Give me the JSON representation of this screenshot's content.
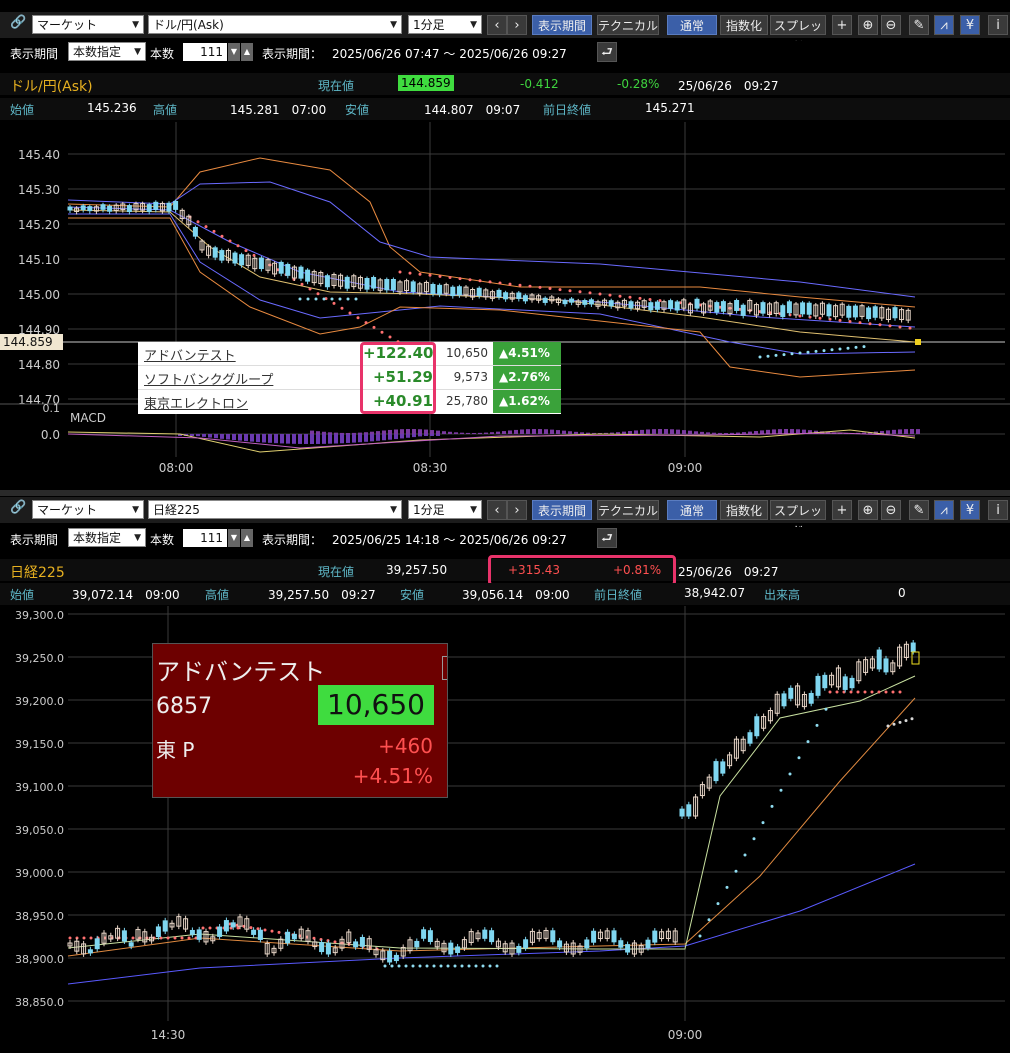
{
  "top": {
    "toolbar": {
      "market": "マーケット",
      "symbol": "ドル/円(Ask)",
      "interval": "1分足",
      "prev": "‹",
      "next": "›",
      "display_period": "表示期間",
      "technical": "テクニカル",
      "normal": "通常",
      "index": "指数化",
      "spread": "スプレッド"
    },
    "period_row": {
      "label": "表示期間",
      "mode": "本数指定",
      "count_label": "本数",
      "count": "111",
      "range_label": "表示期間：",
      "range": "2025/06/26 07:47 ～ 2025/06/26 09:27"
    },
    "quote": {
      "name": "ドル/円(Ask)",
      "current_label": "現在値",
      "current": "144.859",
      "change": "-0.412",
      "change_pct": "-0.28%",
      "datetime": "25/06/26　09:27"
    },
    "ohlc": {
      "open_label": "始値",
      "open": "145.236",
      "high_label": "高値",
      "high": "145.281　07:00",
      "low_label": "安値",
      "low": "144.807　09:07",
      "prev_label": "前日終値",
      "prev": "145.271"
    },
    "yticks": [
      "145.40",
      "145.30",
      "145.20",
      "145.10",
      "145.00",
      "144.90",
      "144.80",
      "144.70"
    ],
    "price_tag": "144.859",
    "macd_label": "MACD",
    "macd_zero": "0.0",
    "macd_top": "0.1",
    "xticks": [
      "08:00",
      "08:30",
      "09:00"
    ],
    "popup": [
      {
        "name": "アドバンテスト",
        "change": "+122.40",
        "price": "10,650",
        "pct": "▲4.51%"
      },
      {
        "name": "ソフトバンクグループ",
        "change": "+51.29",
        "price": "9,573",
        "pct": "▲2.76%"
      },
      {
        "name": "東京エレクトロン",
        "change": "+40.91",
        "price": "25,780",
        "pct": "▲1.62%"
      }
    ]
  },
  "bottom": {
    "toolbar": {
      "market": "マーケット",
      "symbol": "日経225",
      "interval": "1分足",
      "prev": "‹",
      "next": "›",
      "display_period": "表示期間",
      "technical": "テクニカル",
      "normal": "通常",
      "index": "指数化",
      "spread": "スプレッド"
    },
    "period_row": {
      "label": "表示期間",
      "mode": "本数指定",
      "count_label": "本数",
      "count": "111",
      "range_label": "表示期間：",
      "range": "2025/06/25 14:18 ～ 2025/06/26 09:27"
    },
    "quote": {
      "name": "日経225",
      "current_label": "現在値",
      "current": "39,257.50",
      "change": "+315.43",
      "change_pct": "+0.81%",
      "datetime": "25/06/26　09:27"
    },
    "ohlc": {
      "open_label": "始値",
      "open": "39,072.14　09:00",
      "high_label": "高値",
      "high": "39,257.50　09:27",
      "low_label": "安値",
      "low": "39,056.14　09:00",
      "prev_label": "前日終値",
      "prev": "38,942.07",
      "volume_label": "出来高",
      "volume": "0"
    },
    "yticks": [
      "39,300.0",
      "39,250.0",
      "39,200.0",
      "39,150.0",
      "39,100.0",
      "39,050.0",
      "39,000.0",
      "38,950.0",
      "38,900.0",
      "38,850.0"
    ],
    "xticks": [
      "14:30",
      "09:00"
    ],
    "stock": {
      "name": "アドバンテスト",
      "code": "6857",
      "price": "10,650",
      "market": "東 P",
      "change": "+460",
      "pct": "+4.51%"
    }
  },
  "colors": {
    "up_candle": "#e8d6c8",
    "down_candle": "#7fd6f0",
    "band_outer": "#e88a40",
    "band_inner": "#6a6aff",
    "sar": "#ff7070",
    "ma_short": "#d8c060",
    "highlight": "#e8336a"
  }
}
